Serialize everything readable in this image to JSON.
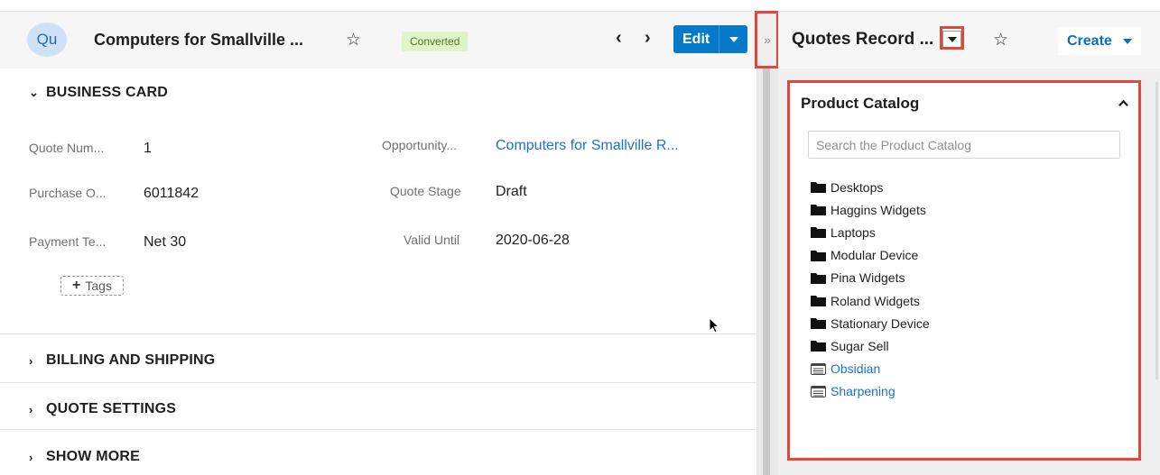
{
  "record": {
    "avatar_initials": "Qu",
    "title": "Computers for Smallville ...",
    "status_badge": "Converted",
    "edit_label": "Edit"
  },
  "sections": {
    "business_card": "BUSINESS CARD",
    "billing_shipping": "BILLING AND SHIPPING",
    "quote_settings": "QUOTE SETTINGS",
    "show_more": "SHOW MORE"
  },
  "fields": {
    "quote_number": {
      "label": "Quote Num...",
      "value": "1"
    },
    "opportunity": {
      "label": "Opportunity...",
      "value": "Computers for Smallville R..."
    },
    "purchase_order": {
      "label": "Purchase O...",
      "value": "6011842"
    },
    "quote_stage": {
      "label": "Quote Stage",
      "value": "Draft"
    },
    "payment_terms": {
      "label": "Payment Te...",
      "value": "Net 30"
    },
    "valid_until": {
      "label": "Valid Until",
      "value": "2020-06-28"
    }
  },
  "tags_label": "Tags",
  "right_panel": {
    "title": "Quotes Record ...",
    "create_label": "Create",
    "catalog": {
      "title": "Product Catalog",
      "search_placeholder": "Search the Product Catalog",
      "items": [
        {
          "label": "Desktops",
          "type": "folder-icon"
        },
        {
          "label": "Haggins Widgets",
          "type": "folder-icon"
        },
        {
          "label": "Laptops",
          "type": "folder-icon"
        },
        {
          "label": "Modular Device",
          "type": "folder-icon"
        },
        {
          "label": "Pina Widgets",
          "type": "folder-icon"
        },
        {
          "label": "Roland Widgets",
          "type": "folder-icon"
        },
        {
          "label": "Stationary Device",
          "type": "folder-icon"
        },
        {
          "label": "Sugar Sell",
          "type": "folder-icon"
        },
        {
          "label": "Obsidian",
          "type": "product-icon"
        },
        {
          "label": "Sharpening",
          "type": "product-icon"
        }
      ]
    }
  },
  "colors": {
    "accent": "#0679c8",
    "link": "#1a73c7",
    "highlight": "#e0493a",
    "badge_bg": "#dff4c8"
  }
}
